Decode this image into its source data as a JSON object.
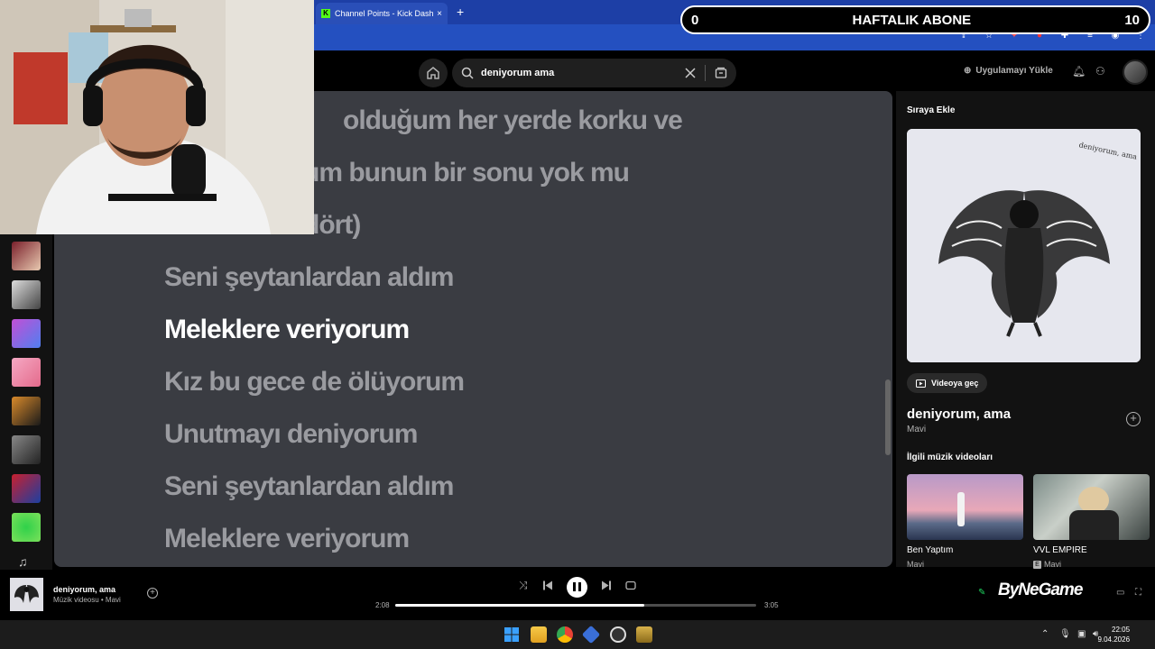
{
  "browser": {
    "tab_title": "Channel Points - Kick Dashboard",
    "new_tab": "+",
    "tab_close": "×"
  },
  "overlay": {
    "left_count": "0",
    "label": "HAFTALIK ABONE",
    "right_count": "10"
  },
  "header": {
    "search_query": "deniyorum ama",
    "install_label": "Uygulamayı Yükle"
  },
  "lyrics": [
    {
      "text": "olduğum her yerde korku ve",
      "active": false
    },
    {
      "text": "um bunun bir sonu yok mu",
      "active": false
    },
    {
      "text": "dört)",
      "active": false
    },
    {
      "text": "Seni şeytanlardan aldım",
      "active": false
    },
    {
      "text": "Meleklere veriyorum",
      "active": true
    },
    {
      "text": "Kız bu gece de ölüyorum",
      "active": false
    },
    {
      "text": "Unutmayı deniyorum",
      "active": false
    },
    {
      "text": "Seni şeytanlardan aldım",
      "active": false
    },
    {
      "text": "Meleklere veriyorum",
      "active": false
    }
  ],
  "right_panel": {
    "queue_title": "Sıraya Ekle",
    "cover_text": "deniyorum, ama",
    "video_button": "Videoya geç",
    "song_title": "deniyorum, ama",
    "artist": "Mavi",
    "related_title": "İlgili müzik videoları",
    "related": [
      {
        "title": "Ben Yaptım",
        "artist": "Mavi"
      },
      {
        "title": "VVL EMPIRE",
        "artist": "Mavi"
      }
    ]
  },
  "player": {
    "title": "deniyorum, ama",
    "subtitle": "Müzik videosu • Mavi",
    "elapsed": "2:08",
    "duration": "3:05",
    "progress_fraction": 0.69,
    "brand": "ByNeGame"
  },
  "taskbar": {
    "time": "22:05",
    "date": "9.04.2026"
  }
}
